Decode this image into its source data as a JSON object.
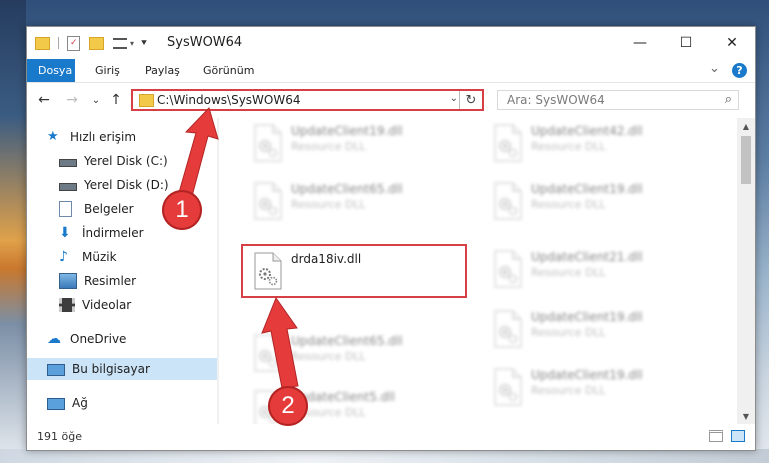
{
  "window": {
    "title": "SysWOW64",
    "controls": {
      "minimize": "—",
      "maximize": "☐",
      "close": "✕"
    }
  },
  "ribbon": {
    "tabs": [
      "Dosya",
      "Giriş",
      "Paylaş",
      "Görünüm"
    ],
    "collapse": "⌄",
    "help": "?"
  },
  "nav": {
    "back": "←",
    "forward": "→",
    "recent": "⌄",
    "up": "↑",
    "address": "C:\\Windows\\SysWOW64",
    "address_dropdown": "⌄",
    "refresh": "↻",
    "search_placeholder": "Ara: SysWOW64",
    "search_icon": "⌕"
  },
  "sidebar": {
    "items": [
      {
        "label": "Hızlı erişim",
        "icon": "star-icon",
        "pinned": false
      },
      {
        "label": "Yerel Disk (C:)",
        "icon": "drive-icon",
        "pinned": true
      },
      {
        "label": "Yerel Disk (D:)",
        "icon": "drive-icon",
        "pinned": true
      },
      {
        "label": "Belgeler",
        "icon": "documents-icon",
        "pinned": true
      },
      {
        "label": "İndirmeler",
        "icon": "download-icon",
        "pinned": true
      },
      {
        "label": "Müzik",
        "icon": "music-icon",
        "pinned": true
      },
      {
        "label": "Resimler",
        "icon": "pictures-icon",
        "pinned": true
      },
      {
        "label": "Videolar",
        "icon": "videos-icon",
        "pinned": true
      },
      {
        "label": "OneDrive",
        "icon": "onedrive-icon",
        "pinned": false
      },
      {
        "label": "Bu bilgisayar",
        "icon": "computer-icon",
        "pinned": false
      },
      {
        "label": "Ağ",
        "icon": "network-icon",
        "pinned": false
      }
    ]
  },
  "files": {
    "left": [
      {
        "name": "UpdateClient19.dll",
        "type": "Resource DLL"
      },
      {
        "name": "UpdateClient65.dll",
        "type": "Resource DLL"
      },
      {
        "name": "drda18iv.dll",
        "type": ""
      },
      {
        "name": "UpdateClient65.dll",
        "type": "Resource DLL"
      },
      {
        "name": "UpdateClient5.dll",
        "type": "Resource DLL"
      }
    ],
    "right": [
      {
        "name": "UpdateClient42.dll",
        "type": "Resource DLL"
      },
      {
        "name": "UpdateClient19.dll",
        "type": "Resource DLL"
      },
      {
        "name": "UpdateClient21.dll",
        "type": "Resource DLL"
      },
      {
        "name": "UpdateClient19.dll",
        "type": "Resource DLL"
      },
      {
        "name": "UpdateClient19.dll",
        "type": "Resource DLL"
      }
    ]
  },
  "status": {
    "count": "191 öğe"
  },
  "annotations": {
    "marker1": "1",
    "marker2": "2"
  },
  "colors": {
    "accent": "#1979ca",
    "highlight": "#d64045",
    "marker": "#e53b3b",
    "selection": "#cce4f7"
  }
}
